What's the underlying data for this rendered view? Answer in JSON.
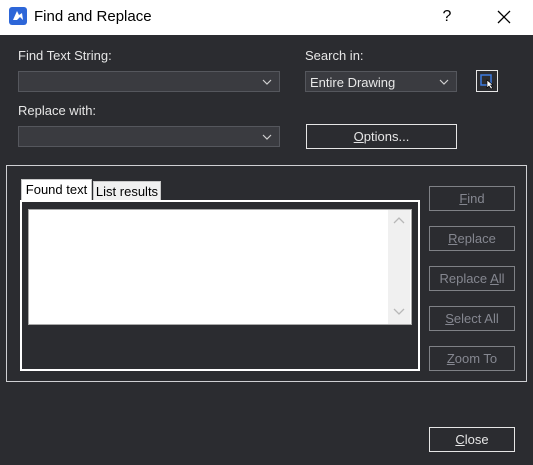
{
  "window": {
    "title": "Find and Replace",
    "help_label": "?",
    "close_label": "✕"
  },
  "find": {
    "label": "Find Text String:",
    "value": ""
  },
  "search_in": {
    "label": "Search in:",
    "value": "Entire Drawing"
  },
  "replace": {
    "label": "Replace with:",
    "value": ""
  },
  "options_button": {
    "mnemonic": "O",
    "rest": "ptions..."
  },
  "tabs": [
    {
      "label": "Found text",
      "active": true
    },
    {
      "label": "List results",
      "active": false
    }
  ],
  "side_buttons": [
    {
      "mnemonic": "F",
      "rest": "ind",
      "prefix": ""
    },
    {
      "mnemonic": "R",
      "rest": "eplace",
      "prefix": ""
    },
    {
      "prefix": "Replace ",
      "mnemonic": "A",
      "rest": "ll"
    },
    {
      "prefix": "",
      "mnemonic": "S",
      "rest": "elect All"
    },
    {
      "prefix": "",
      "mnemonic": "Z",
      "rest": "oom To"
    }
  ],
  "close_button": {
    "mnemonic": "C",
    "rest": "lose"
  },
  "icons": {
    "app": "app-logo-icon",
    "select_objects": "select-objects-icon",
    "dropdown": "chevron-down-icon"
  }
}
